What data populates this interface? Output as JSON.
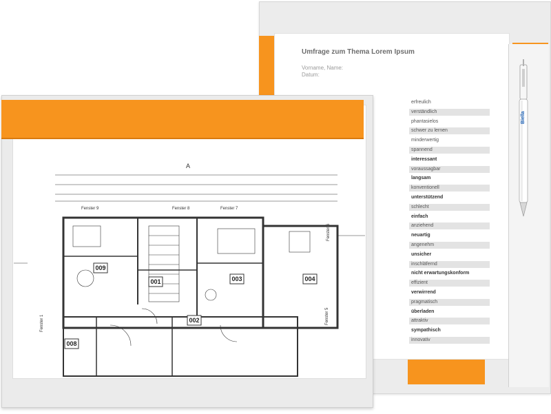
{
  "survey": {
    "title": "Umfrage zum Thema Lorem Ipsum",
    "vorname": "Vorname, Name:",
    "datum": "Datum:",
    "items": [
      {
        "label": "erfreulich",
        "bold": false
      },
      {
        "label": "verständlich",
        "bold": false
      },
      {
        "label": "phantasielos",
        "bold": false
      },
      {
        "label": "schwer zu lernen",
        "bold": false
      },
      {
        "label": "minderwertig",
        "bold": false
      },
      {
        "label": "spannend",
        "bold": false
      },
      {
        "label": "interessant",
        "bold": true
      },
      {
        "label": "voraussagbar",
        "bold": false
      },
      {
        "label": "langsam",
        "bold": true
      },
      {
        "label": "konventionell",
        "bold": false
      },
      {
        "label": "unterstützend",
        "bold": true
      },
      {
        "label": "schlecht",
        "bold": false
      },
      {
        "label": "einfach",
        "bold": true
      },
      {
        "label": "anziehend",
        "bold": false
      },
      {
        "label": "neuartig",
        "bold": true
      },
      {
        "label": "angenehm",
        "bold": false
      },
      {
        "label": "unsicher",
        "bold": true
      },
      {
        "label": "inschläfernd",
        "bold": false
      },
      {
        "label": "nicht erwartungskonform",
        "bold": true
      },
      {
        "label": "effizient",
        "bold": false
      },
      {
        "label": "verwirrend",
        "bold": true
      },
      {
        "label": "pragmatisch",
        "bold": false
      },
      {
        "label": "überladen",
        "bold": true
      },
      {
        "label": "attraktiv",
        "bold": false
      },
      {
        "label": "sympathisch",
        "bold": true
      },
      {
        "label": "innovativ",
        "bold": false
      }
    ],
    "pen_brand": "Biella"
  },
  "plan": {
    "rooms": [
      "009",
      "001",
      "003",
      "004",
      "002",
      "008"
    ],
    "windows": [
      "Fenster 9",
      "Fenster 8",
      "Fenster 7",
      "Fenster 6",
      "Fenster 5",
      "Fenster 1"
    ],
    "north_arrow": "A"
  },
  "colors": {
    "accent": "#f7941e",
    "clipboard": "#ececec",
    "paper": "#ffffff",
    "ink": "#3a3a3a"
  }
}
